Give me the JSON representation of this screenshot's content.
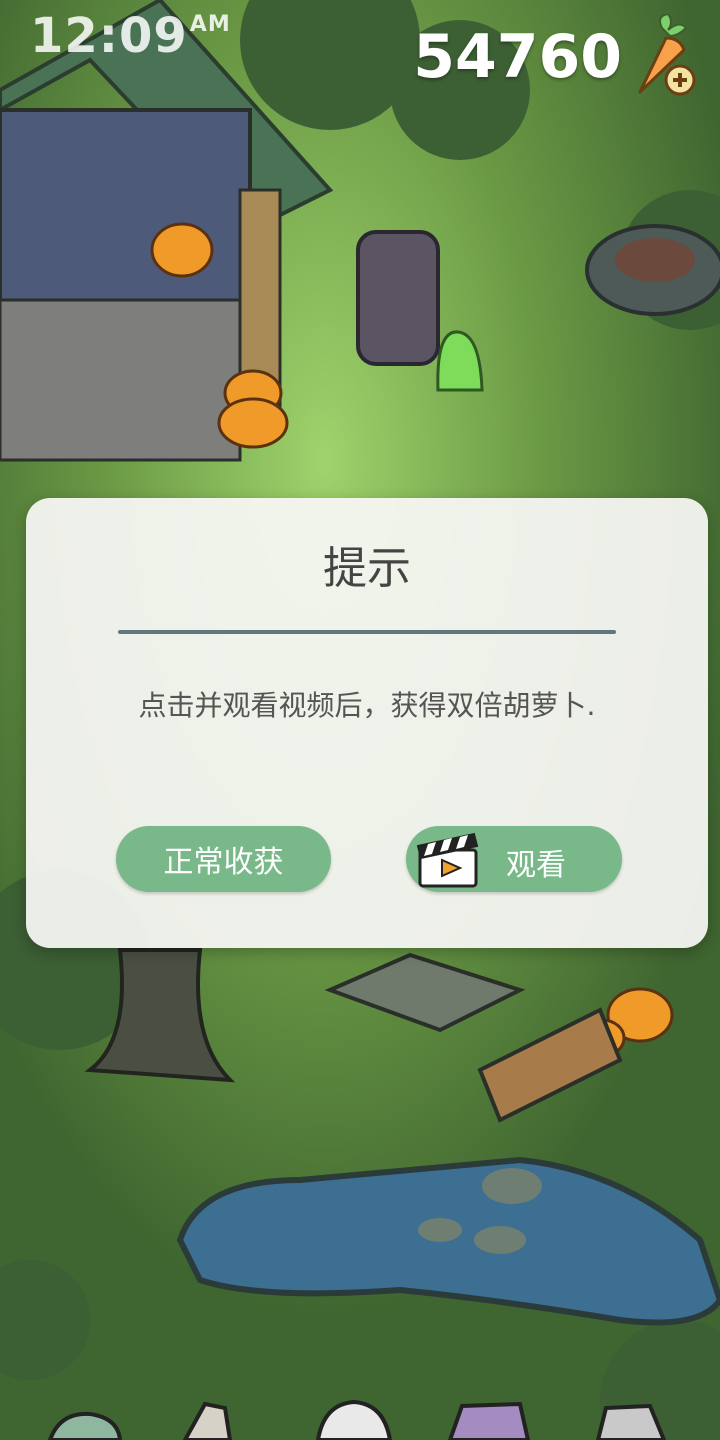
{
  "status_bar": {
    "time": "12:09",
    "ampm": "AM"
  },
  "hud": {
    "carrot_count": "54760",
    "carrot_icon": "carrot-plus-icon"
  },
  "dialog": {
    "title": "提示",
    "message": "点击并观看视频后，获得双倍胡萝卜.",
    "normal_button_label": "正常收获",
    "watch_button_label": "观看",
    "watch_icon": "video-clapperboard-icon"
  },
  "colors": {
    "button_green": "#79b989",
    "dialog_background": "#f6f6f3",
    "divider": "#63767d",
    "grass": "#4f7a3a"
  }
}
